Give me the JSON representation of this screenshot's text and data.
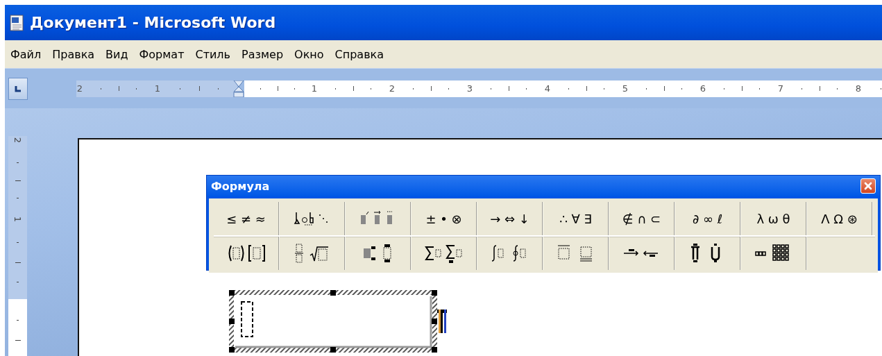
{
  "window": {
    "title": "Документ1 - Microsoft Word"
  },
  "menu": [
    {
      "label": "Файл"
    },
    {
      "label": "Правка"
    },
    {
      "label": "Вид"
    },
    {
      "label": "Формат"
    },
    {
      "label": "Стиль"
    },
    {
      "label": "Размер"
    },
    {
      "label": "Окно"
    },
    {
      "label": "Справка"
    }
  ],
  "ruler": {
    "left_labels": [
      "2",
      "1"
    ],
    "right_labels": [
      "1",
      "2",
      "3",
      "4",
      "5",
      "6",
      "7",
      "8"
    ]
  },
  "vertical_ruler": {
    "labels": [
      "2",
      "1"
    ]
  },
  "formula_toolbar": {
    "title": "Формула",
    "rows": [
      [
        {
          "kind": "symbols",
          "label": "≤ ≠ ≈"
        },
        {
          "kind": "spacing"
        },
        {
          "kind": "embellishments"
        },
        {
          "kind": "symbols",
          "label": "± • ⊗"
        },
        {
          "kind": "symbols",
          "label": "→ ⇔ ↓"
        },
        {
          "kind": "symbols",
          "label": "∴ ∀ ∃"
        },
        {
          "kind": "symbols",
          "label": "∉ ∩ ⊂"
        },
        {
          "kind": "symbols",
          "label": "∂ ∞ ℓ"
        },
        {
          "kind": "symbols",
          "label": "λ ω θ"
        },
        {
          "kind": "symbols",
          "label": "Λ Ω ⊛"
        }
      ],
      [
        {
          "kind": "fences"
        },
        {
          "kind": "fractions"
        },
        {
          "kind": "scripts"
        },
        {
          "kind": "sums"
        },
        {
          "kind": "integrals"
        },
        {
          "kind": "bars"
        },
        {
          "kind": "arrows"
        },
        {
          "kind": "products"
        },
        {
          "kind": "matrices"
        }
      ]
    ]
  }
}
